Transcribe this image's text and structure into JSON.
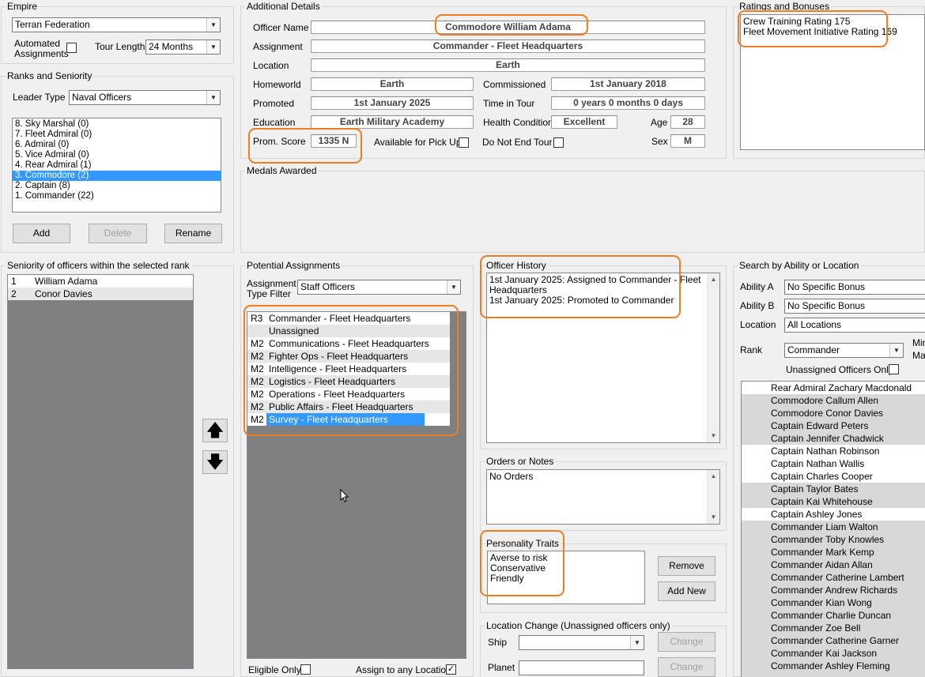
{
  "empire": {
    "title": "Empire",
    "selected": "Terran Federation",
    "automated_label": "Automated Assignments",
    "tour_length_label": "Tour Length",
    "tour_length": "24 Months"
  },
  "ranks": {
    "title": "Ranks and Seniority",
    "leader_type_label": "Leader Type",
    "leader_type": "Naval Officers",
    "items": [
      "8. Sky Marshal  (0)",
      "7. Fleet Admiral  (0)",
      "6. Admiral  (0)",
      "5. Vice Admiral  (0)",
      "4. Rear Admiral  (1)",
      "3. Commodore  (2)",
      "2. Captain  (8)",
      "1. Commander  (22)"
    ],
    "add_label": "Add",
    "delete_label": "Delete",
    "rename_label": "Rename"
  },
  "details": {
    "title": "Additional Details",
    "officer_name_label": "Officer Name",
    "officer_name": "Commodore William Adama",
    "assignment_label": "Assignment",
    "assignment": "Commander - Fleet Headquarters",
    "location_label": "Location",
    "location": "Earth",
    "homeworld_label": "Homeworld",
    "homeworld": "Earth",
    "commissioned_label": "Commissioned",
    "commissioned": "1st January 2018",
    "promoted_label": "Promoted",
    "promoted": "1st January 2025",
    "time_in_tour_label": "Time in Tour",
    "time_in_tour": "0 years 0 months 0 days",
    "education_label": "Education",
    "education": "Earth Military Academy",
    "health_label": "Health Condition",
    "health": "Excellent",
    "age_label": "Age",
    "age": "28",
    "prom_score_label": "Prom. Score",
    "prom_score": "1335 N",
    "pickup_label": "Available for Pick Up",
    "do_not_end_label": "Do Not End Tour",
    "sex_label": "Sex",
    "sex": "M"
  },
  "ratings": {
    "title": "Ratings and Bonuses",
    "items": [
      "Crew Training Rating 175",
      "Fleet Movement Initiative Rating 169"
    ]
  },
  "medals": {
    "title": "Medals Awarded"
  },
  "seniority": {
    "title": "Seniority of officers within the selected rank",
    "rows": [
      {
        "num": "1",
        "name": "William Adama"
      },
      {
        "num": "2",
        "name": "Conor Davies"
      }
    ]
  },
  "potential": {
    "title": "Potential Assignments",
    "filter_label": "Assignment Type Filter",
    "filter": "Staff Officers",
    "rows": [
      {
        "code": "R3",
        "name": "Commander - Fleet Headquarters"
      },
      {
        "code": "",
        "name": "Unassigned"
      },
      {
        "code": "M2",
        "name": "Communications - Fleet Headquarters"
      },
      {
        "code": "M2",
        "name": "Fighter Ops - Fleet Headquarters"
      },
      {
        "code": "M2",
        "name": "Intelligence - Fleet Headquarters"
      },
      {
        "code": "M2",
        "name": "Logistics - Fleet Headquarters"
      },
      {
        "code": "M2",
        "name": "Operations - Fleet Headquarters"
      },
      {
        "code": "M2",
        "name": "Public Affairs - Fleet Headquarters"
      },
      {
        "code": "M2",
        "name": "Survey - Fleet Headquarters"
      }
    ],
    "eligible_label": "Eligible Only",
    "any_location_label": "Assign to any Location"
  },
  "history": {
    "title": "Officer History",
    "lines": [
      "1st January 2025: Assigned to Commander - Fleet",
      "Headquarters",
      "1st January 2025: Promoted to Commander"
    ]
  },
  "orders": {
    "title": "Orders or Notes",
    "text": "No Orders"
  },
  "traits": {
    "title": "Personality Traits",
    "items": [
      "Averse to risk",
      "Conservative",
      "Friendly"
    ],
    "remove_label": "Remove",
    "add_new_label": "Add New"
  },
  "locchange": {
    "title": "Location Change (Unassigned officers only)",
    "ship_label": "Ship",
    "planet_label": "Planet",
    "change_label": "Change"
  },
  "search": {
    "title": "Search by Ability or Location",
    "ability_a_label": "Ability A",
    "ability_a": "No Specific Bonus",
    "ability_b_label": "Ability B",
    "ability_b": "No Specific Bonus",
    "location_label": "Location",
    "location": "All Locations",
    "rank_label": "Rank",
    "rank": "Commander",
    "min_label": "Min",
    "max_label": "Ma",
    "unassigned_label": "Unassigned Officers Only",
    "results": [
      "Rear Admiral Zachary Macdonald",
      "Commodore Callum Allen",
      "Commodore Conor Davies",
      "Captain Edward Peters",
      "Captain Jennifer Chadwick",
      "Captain Nathan Robinson",
      "Captain Nathan Wallis",
      "Captain Charles Cooper",
      "Captain Taylor Bates",
      "Captain Kai Whitehouse",
      "Captain Ashley Jones",
      "Commander Liam Walton",
      "Commander Toby Knowles",
      "Commander Mark Kemp",
      "Commander Aidan Allan",
      "Commander Catherine Lambert",
      "Commander Andrew Richards",
      "Commander Kian Wong",
      "Commander Charlie Duncan",
      "Commander Zoe Bell",
      "Commander Catherine Garner",
      "Commander Kai Jackson",
      "Commander Ashley Fleming"
    ]
  },
  "colors": {
    "selection": "#3399ff",
    "highlight": "#ef7d22",
    "dark_list": "#808080"
  }
}
